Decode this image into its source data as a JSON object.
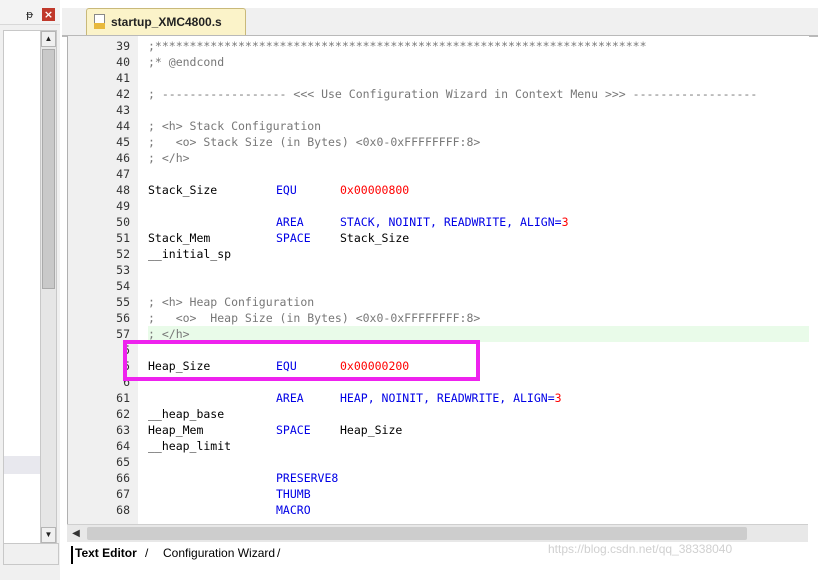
{
  "left_panel": {
    "pin_icon": "pin-icon",
    "pin_glyph": "ᵽ",
    "close_glyph": "×",
    "scroll_up_glyph": "▲",
    "scroll_down_glyph": "▼"
  },
  "editor_tab": {
    "filename": "startup_XMC4800.s"
  },
  "code": {
    "lines": [
      {
        "n": "39",
        "t": ";***********************************************************************"
      },
      {
        "n": "40",
        "t": ";* @endcond"
      },
      {
        "n": "41",
        "t": ""
      },
      {
        "n": "42",
        "t": "; ------------------ <<< Use Configuration Wizard in Context Menu >>> ------------------"
      },
      {
        "n": "43",
        "t": ""
      },
      {
        "n": "44",
        "t": "; <h> Stack Configuration"
      },
      {
        "n": "45",
        "t": ";   <o> Stack Size (in Bytes) <0x0-0xFFFFFFFF:8>"
      },
      {
        "n": "46",
        "t": "; </h>"
      },
      {
        "n": "47",
        "t": ""
      },
      {
        "n": "48",
        "label": "Stack_Size",
        "op": "EQU",
        "arg": "0x00000800"
      },
      {
        "n": "49",
        "t": ""
      },
      {
        "n": "50",
        "op": "AREA",
        "arg": "STACK, NOINIT, READWRITE, ALIGN=3"
      },
      {
        "n": "51",
        "label": "Stack_Mem",
        "op": "SPACE",
        "arg": "Stack_Size"
      },
      {
        "n": "52",
        "label": "__initial_sp"
      },
      {
        "n": "53",
        "t": ""
      },
      {
        "n": "54",
        "t": ""
      },
      {
        "n": "55",
        "t": "; <h> Heap Configuration"
      },
      {
        "n": "56",
        "t": ";   <o>  Heap Size (in Bytes) <0x0-0xFFFFFFFF:8>"
      },
      {
        "n": "57",
        "t": "; </h>"
      },
      {
        "n": "5",
        "t": ""
      },
      {
        "n": "5",
        "label": "Heap_Size",
        "op": "EQU",
        "arg": "0x00000200"
      },
      {
        "n": "6",
        "t": ""
      },
      {
        "n": "61",
        "op": "AREA",
        "arg": "HEAP, NOINIT, READWRITE, ALIGN=3"
      },
      {
        "n": "62",
        "label": "__heap_base"
      },
      {
        "n": "63",
        "label": "Heap_Mem",
        "op": "SPACE",
        "arg": "Heap_Size"
      },
      {
        "n": "64",
        "label": "__heap_limit"
      },
      {
        "n": "65",
        "t": ""
      },
      {
        "n": "66",
        "op": "PRESERVE8"
      },
      {
        "n": "67",
        "op": "THUMB"
      },
      {
        "n": "68",
        "op": "MACRO"
      }
    ]
  },
  "bottom_tabs": {
    "text_editor": "Text Editor",
    "config_wizard": "Configuration Wizard"
  },
  "watermark": "https://blog.csdn.net/qq_38338040",
  "colors": {
    "comment": "#777777",
    "keyword": "#0000e6",
    "number": "#ff0000",
    "highlight_row": "#e9fbe9",
    "annotation_box": "#ee22ee"
  }
}
